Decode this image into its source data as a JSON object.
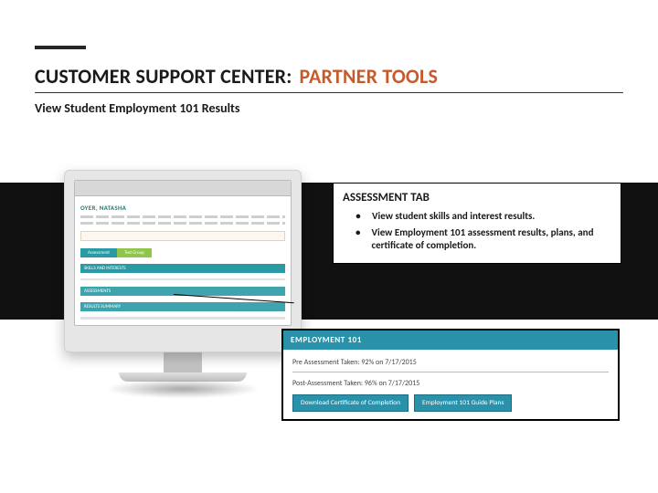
{
  "header": {
    "title_plain": "CUSTOMER SUPPORT CENTER:",
    "title_highlight": "PARTNER TOOLS",
    "subtitle": "View Student Employment 101 Results"
  },
  "monitor": {
    "user_name": "OYER, NATASHA",
    "tab_assessment": "Assessment",
    "tab_test_group": "Test Group",
    "section_skills": "SKILLS AND INTERESTS",
    "section_assess": "ASSESSMENTS",
    "section_results": "RESULTS SUMMARY"
  },
  "card": {
    "heading": "ASSESSMENT TAB",
    "items": [
      "View student skills and interest results.",
      "View Employment 101 assessment results, plans, and certificate of completion."
    ]
  },
  "emp_panel": {
    "heading": "EMPLOYMENT 101",
    "pre_line": "Pre Assessment Taken: 92% on 7/17/2015",
    "post_line": "Post-Assessment Taken: 96% on 7/17/2015",
    "btn_download": "Download Certificate of Completion",
    "btn_guide": "Employment 101 Guide Plans"
  }
}
